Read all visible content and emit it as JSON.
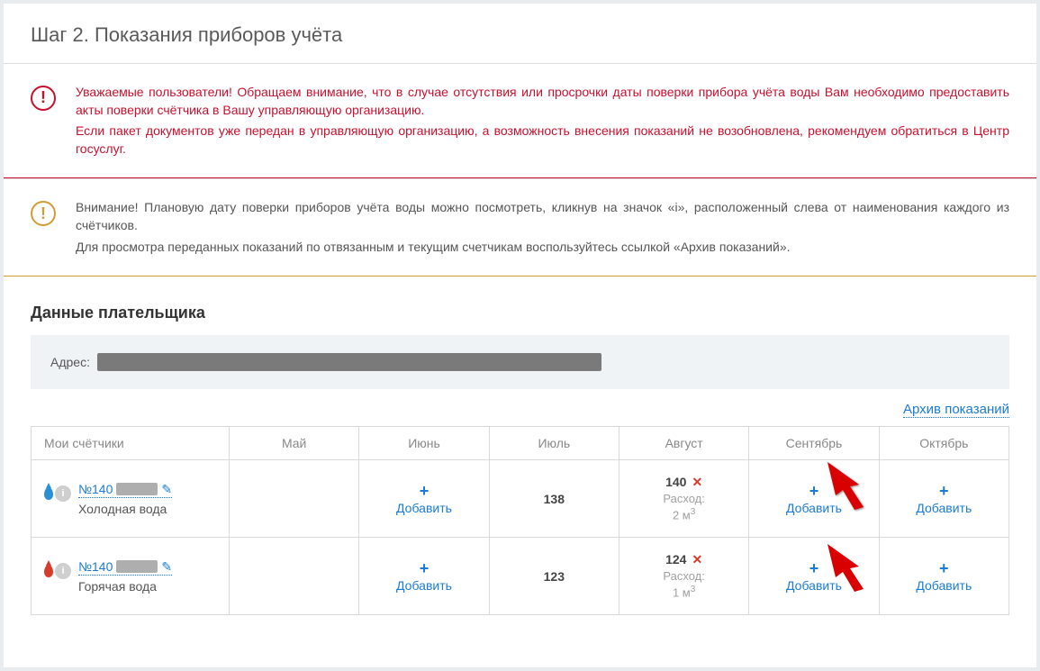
{
  "page_title": "Шаг 2. Показания приборов учёта",
  "alert_red": {
    "p1": "Уважаемые пользователи! Обращаем внимание, что в случае отсутствия или просрочки даты поверки прибора учёта воды Вам необходимо предоставить акты поверки счётчика в Вашу управляющую организацию.",
    "p2": "Если пакет документов уже передан в управляющую организацию, а возможность внесения показаний не возобновлена, рекомендуем обратиться в Центр госуслуг."
  },
  "alert_amber": {
    "p1": "Внимание! Плановую дату поверки приборов учёта воды можно посмотреть, кликнув на значок «i», расположенный слева от наименования каждого из счётчиков.",
    "p2": "Для просмотра переданных показаний по отвязанным и текущим счетчикам воспользуйтесь ссылкой «Архив показаний»."
  },
  "payer": {
    "section_title": "Данные плательщика",
    "address_label": "Адрес:"
  },
  "archive_link": "Архив показаний",
  "table": {
    "headers": {
      "col0": "Мои счётчики",
      "col1": "Май",
      "col2": "Июнь",
      "col3": "Июль",
      "col4": "Август",
      "col5": "Сентябрь",
      "col6": "Октябрь"
    },
    "add_label": "Добавить",
    "consumption_label": "Расход:",
    "rows": [
      {
        "number_prefix": "№140",
        "type": "Холодная вода",
        "july": "138",
        "august_value": "140",
        "august_consumption": "2 м",
        "august_consumption_sup": "3"
      },
      {
        "number_prefix": "№140",
        "type": "Горячая вода",
        "july": "123",
        "august_value": "124",
        "august_consumption": "1 м",
        "august_consumption_sup": "3"
      }
    ]
  }
}
